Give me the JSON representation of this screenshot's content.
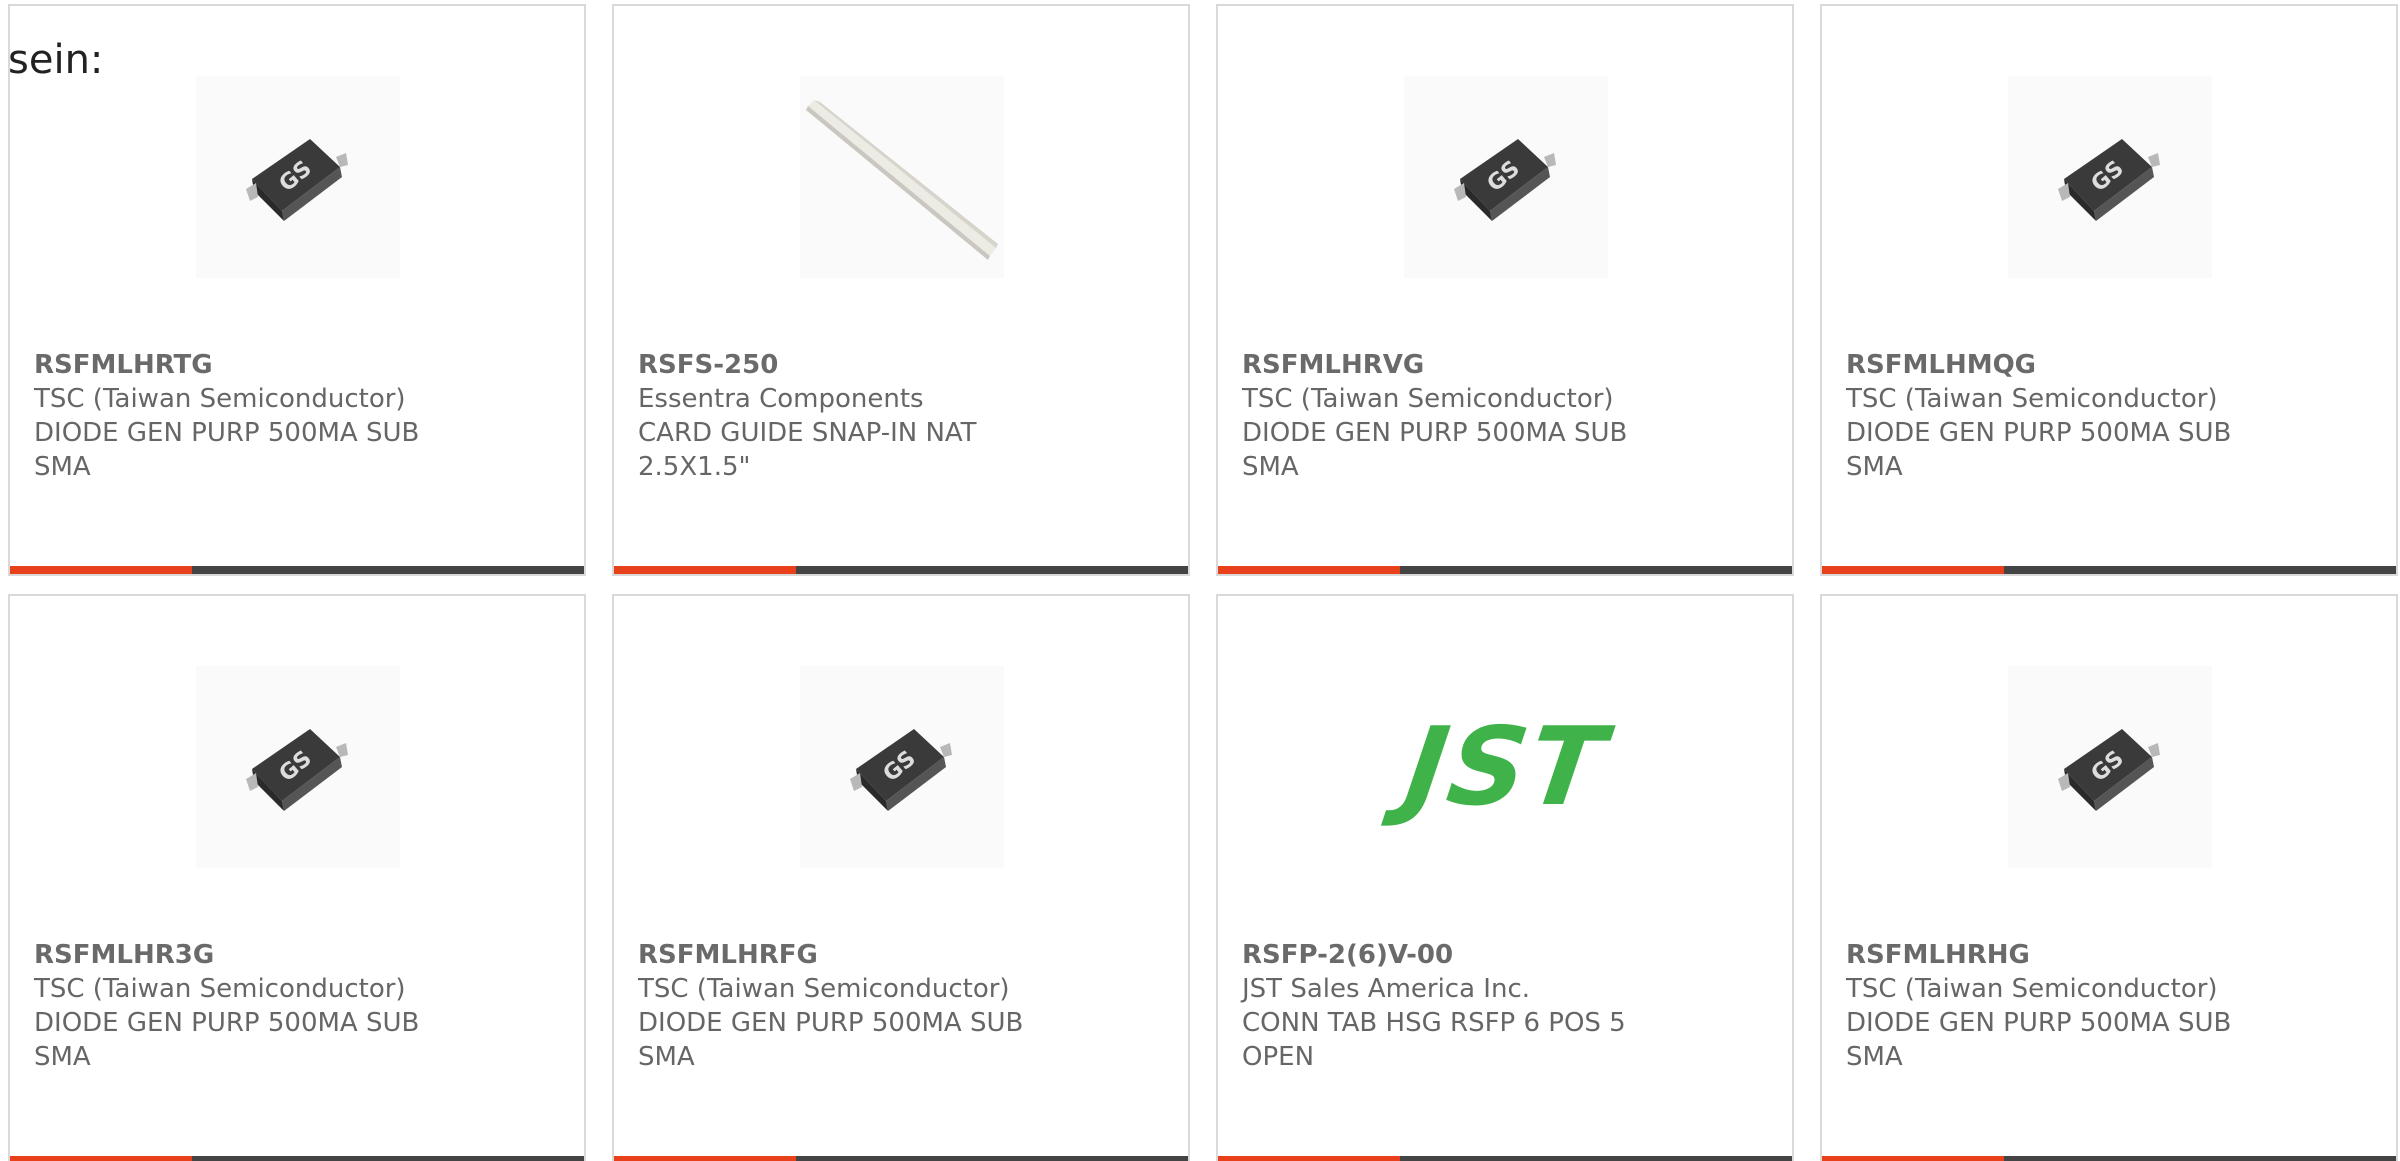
{
  "intro_text": "sein:",
  "colors": {
    "accent_bar": "#e8401b",
    "bar": "#444444",
    "card_border": "#d9d9d9",
    "text": "#666666",
    "jst_green": "#3fb34a"
  },
  "products": [
    {
      "part_number": "RSFMLHRTG",
      "manufacturer": "TSC (Taiwan Semiconductor)",
      "description": "DIODE GEN PURP 500MA SUB SMA",
      "image": "sma-diode-package-icon"
    },
    {
      "part_number": "RSFS-250",
      "manufacturer": "Essentra Components",
      "description": "CARD GUIDE SNAP-IN NAT 2.5X1.5\"",
      "image": "card-guide-rail-icon"
    },
    {
      "part_number": "RSFMLHRVG",
      "manufacturer": "TSC (Taiwan Semiconductor)",
      "description": "DIODE GEN PURP 500MA SUB SMA",
      "image": "sma-diode-package-icon"
    },
    {
      "part_number": "RSFMLHMQG",
      "manufacturer": "TSC (Taiwan Semiconductor)",
      "description": "DIODE GEN PURP 500MA SUB SMA",
      "image": "sma-diode-package-icon"
    },
    {
      "part_number": "RSFMLHR3G",
      "manufacturer": "TSC (Taiwan Semiconductor)",
      "description": "DIODE GEN PURP 500MA SUB SMA",
      "image": "sma-diode-package-icon"
    },
    {
      "part_number": "RSFMLHRFG",
      "manufacturer": "TSC (Taiwan Semiconductor)",
      "description": "DIODE GEN PURP 500MA SUB SMA",
      "image": "sma-diode-package-icon"
    },
    {
      "part_number": "RSFP-2(6)V-00",
      "manufacturer": "JST Sales America Inc.",
      "description": "CONN TAB HSG RSFP 6 POS 5 OPEN",
      "image": "jst-logo",
      "logo_text": "JST"
    },
    {
      "part_number": "RSFMLHRHG",
      "manufacturer": "TSC (Taiwan Semiconductor)",
      "description": "DIODE GEN PURP 500MA SUB SMA",
      "image": "sma-diode-package-icon"
    }
  ]
}
